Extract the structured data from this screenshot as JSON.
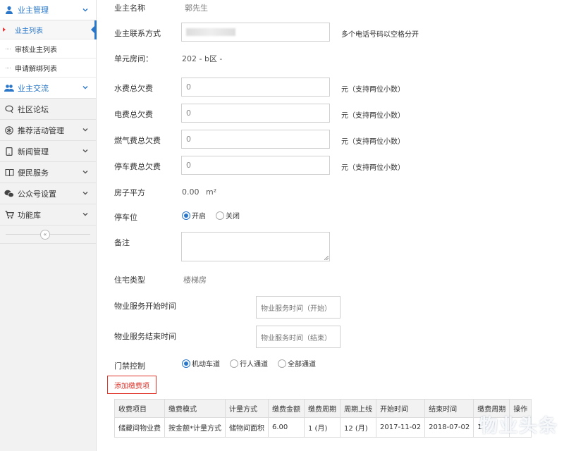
{
  "sidebar": {
    "groups": [
      {
        "label": "业主管理",
        "icon": "user-icon"
      },
      {
        "label": "业主交流",
        "icon": "users-icon"
      },
      {
        "label": "社区论坛",
        "icon": "chat-icon"
      },
      {
        "label": "推荐活动管理",
        "icon": "asterisk-icon"
      },
      {
        "label": "新闻管理",
        "icon": "tablet-icon"
      },
      {
        "label": "便民服务",
        "icon": "book-icon"
      },
      {
        "label": "公众号设置",
        "icon": "wechat-icon"
      },
      {
        "label": "功能库",
        "icon": "cart-icon"
      }
    ],
    "sub_items": [
      "业主列表",
      "审核业主列表",
      "申请解绑列表"
    ],
    "collapse_glyph": "«"
  },
  "form": {
    "owner_name_label": "业主名称",
    "owner_name_value": "郭先生",
    "contact_label": "业主联系方式",
    "contact_hint": "多个电话号码以空格分开",
    "unit_label": "单元房间：",
    "unit_value": "202 - b区 -",
    "water_label": "水费总欠费",
    "water_value": "0",
    "elec_label": "电费总欠费",
    "elec_value": "0",
    "gas_label": "燃气费总欠费",
    "gas_value": "0",
    "parking_fee_label": "停车费总欠费",
    "parking_fee_value": "0",
    "money_hint": "元（支持两位小数）",
    "area_label": "房子平方",
    "area_value": "0.00",
    "area_unit": "m²",
    "parking_label": "停车位",
    "parking_options": [
      "开启",
      "关闭"
    ],
    "parking_selected": 0,
    "remark_label": "备注",
    "house_type_label": "住宅类型",
    "house_type_value": "楼梯房",
    "service_start_label": "物业服务开始时间",
    "service_start_placeholder": "物业服务时间（开始）",
    "service_end_label": "物业服务结束时间",
    "service_end_placeholder": "物业服务时间（结束）",
    "gate_label": "门禁控制",
    "gate_options": [
      "机动车道",
      "行人通道",
      "全部通道"
    ],
    "gate_selected": 0,
    "add_fee_button": "添加缴费项"
  },
  "fee_table": {
    "headers": [
      "收费项目",
      "缴费模式",
      "计量方式",
      "缴费金额",
      "缴费周期",
      "周期上线",
      "开始时间",
      "结束时间",
      "缴费周期",
      "操作"
    ],
    "rows": [
      [
        "储藏间物业费",
        "按金额*计量方式",
        "储物间面积",
        "6.00",
        "1 (月)",
        "12 (月)",
        "2017-11-02",
        "2018-07-02",
        "1",
        ""
      ]
    ]
  },
  "watermark": "物业头条",
  "colors": {
    "accent": "#2a77c9",
    "danger": "#e0352b"
  }
}
